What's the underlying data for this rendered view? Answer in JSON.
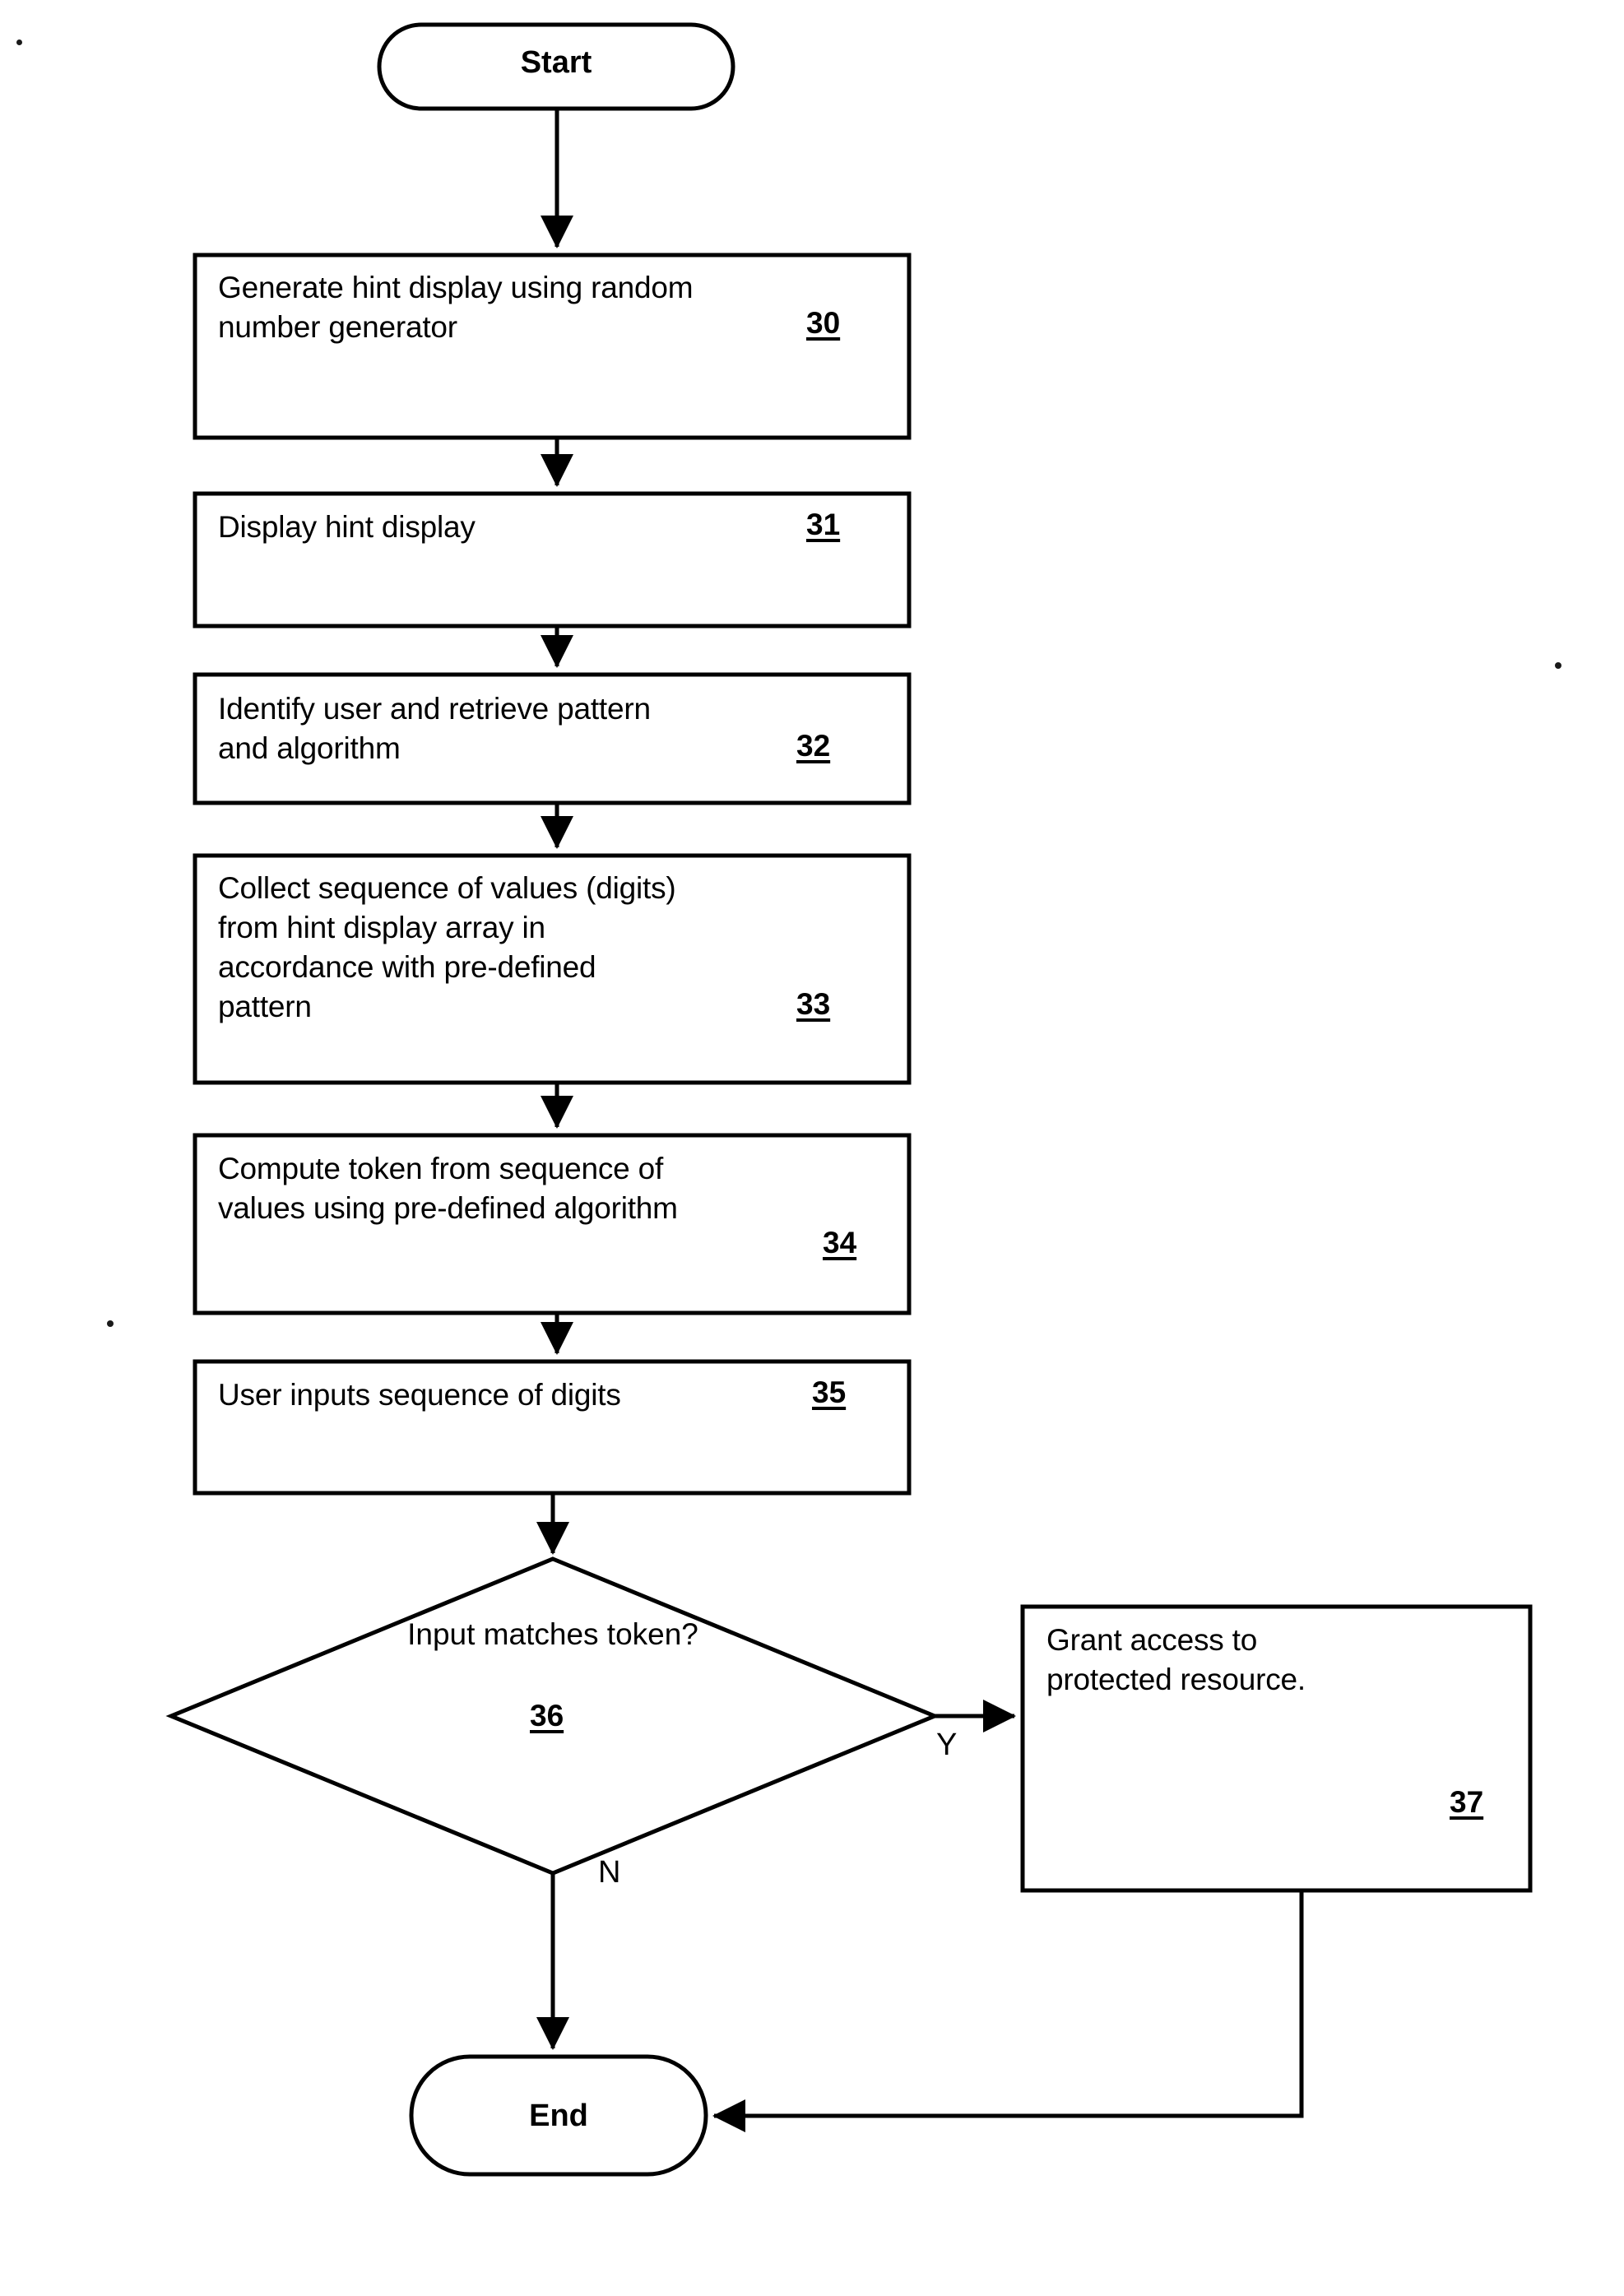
{
  "figure": {
    "type": "flowchart",
    "title": "Token authentication flowchart"
  },
  "nodes": {
    "start": {
      "label": "Start",
      "shape": "terminal"
    },
    "step30": {
      "text": "Generate hint display using random\nnumber generator",
      "ref": "30",
      "shape": "process"
    },
    "step31": {
      "text": "Display hint display",
      "ref": "31",
      "shape": "process"
    },
    "step32": {
      "text": "Identify user and retrieve pattern\nand algorithm",
      "ref": "32",
      "shape": "process"
    },
    "step33": {
      "text": "Collect sequence of values (digits)\nfrom hint display array in\naccordance with pre-defined\npattern",
      "ref": "33",
      "shape": "process"
    },
    "step34": {
      "text": "Compute token from sequence of\nvalues using pre-defined algorithm",
      "ref": "34",
      "shape": "process"
    },
    "step35": {
      "text": "User inputs sequence of digits",
      "ref": "35",
      "shape": "process"
    },
    "decision36": {
      "text": "Input matches\ntoken?",
      "ref": "36",
      "shape": "decision"
    },
    "step37": {
      "text": "Grant access to\nprotected resource.",
      "ref": "37",
      "shape": "process"
    },
    "end": {
      "label": "End",
      "shape": "terminal"
    }
  },
  "edges": {
    "yes_label": "Y",
    "no_label": "N"
  },
  "colors": {
    "stroke": "#000000",
    "background": "#ffffff",
    "text": "#000000"
  }
}
